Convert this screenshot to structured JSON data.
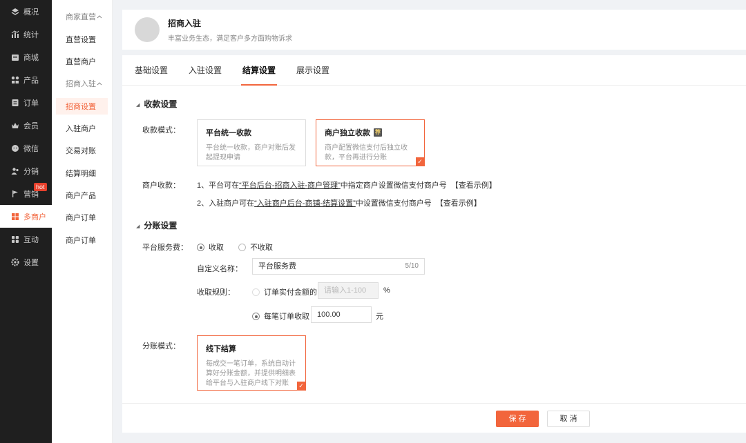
{
  "nav": {
    "items": [
      {
        "label": "概况",
        "icon": "layers-icon"
      },
      {
        "label": "统计",
        "icon": "chart-icon"
      },
      {
        "label": "商城",
        "icon": "shop-icon"
      },
      {
        "label": "产品",
        "icon": "grid-icon"
      },
      {
        "label": "订单",
        "icon": "order-icon"
      },
      {
        "label": "会员",
        "icon": "crown-icon"
      },
      {
        "label": "微信",
        "icon": "wechat-icon"
      },
      {
        "label": "分销",
        "icon": "users-icon"
      },
      {
        "label": "营销",
        "icon": "flag-icon"
      },
      {
        "label": "多商户",
        "icon": "store-icon"
      },
      {
        "label": "互动",
        "icon": "apps-icon"
      },
      {
        "label": "设置",
        "icon": "gear-icon"
      }
    ],
    "hot_badge": "hot"
  },
  "submenu": {
    "group1": "商家直营",
    "direct_settings": "直营设置",
    "direct_merchants": "直营商户",
    "group2": "招商入驻",
    "invite_settings": "招商设置",
    "joined_merchants": "入驻商户",
    "reconciliation": "交易对账",
    "settlement_detail": "结算明细",
    "merchant_products": "商户产品",
    "merchant_orders_1": "商户订单",
    "merchant_orders_2": "商户订单"
  },
  "header": {
    "title": "招商入驻",
    "subtitle": "丰富业务生态，满足客户多方面购物诉求"
  },
  "tabs": [
    "基础设置",
    "入驻设置",
    "结算设置",
    "展示设置"
  ],
  "collect": {
    "section_title": "收款设置",
    "mode_label": "收款模式：",
    "option1_title": "平台统一收款",
    "option1_desc": "平台统一收款，商户对账后发起提现申请",
    "option2_title": "商户独立收款",
    "option2_desc": "商户配置微信支付后独立收款，平台再进行分账",
    "merchant_label": "商户收款：",
    "line1_prefix": "1、平台可在",
    "line1_link": "“平台后台-招商入驻-商户管理”",
    "line1_suffix": "中指定商户设置微信支付商户号",
    "line1_example": "【查看示例】",
    "line2_prefix": "2、入驻商户可在",
    "line2_link": "“入驻商户后台-商铺-结算设置”",
    "line2_suffix": "中设置微信支付商户号",
    "line2_example": "【查看示例】"
  },
  "split": {
    "section_title": "分账设置",
    "fee_label": "平台服务费：",
    "fee_on": "收取",
    "fee_off": "不收取",
    "name_label": "自定义名称：",
    "name_value": "平台服务费",
    "name_counter": "5/10",
    "rule_label": "收取规则：",
    "rule1_label": "订单实付金额的",
    "rule1_placeholder": "请输入1-100",
    "rule1_unit": "%",
    "rule2_label": "每笔订单收取",
    "rule2_value": "100.00",
    "rule2_unit": "元",
    "mode_label": "分账模式：",
    "mode_title": "线下结算",
    "mode_desc": "每成交一笔订单，系统自动计算好分账金额，并提供明细表给平台与入驻商户线下对账"
  },
  "footer": {
    "save": "保 存",
    "cancel": "取 消"
  }
}
